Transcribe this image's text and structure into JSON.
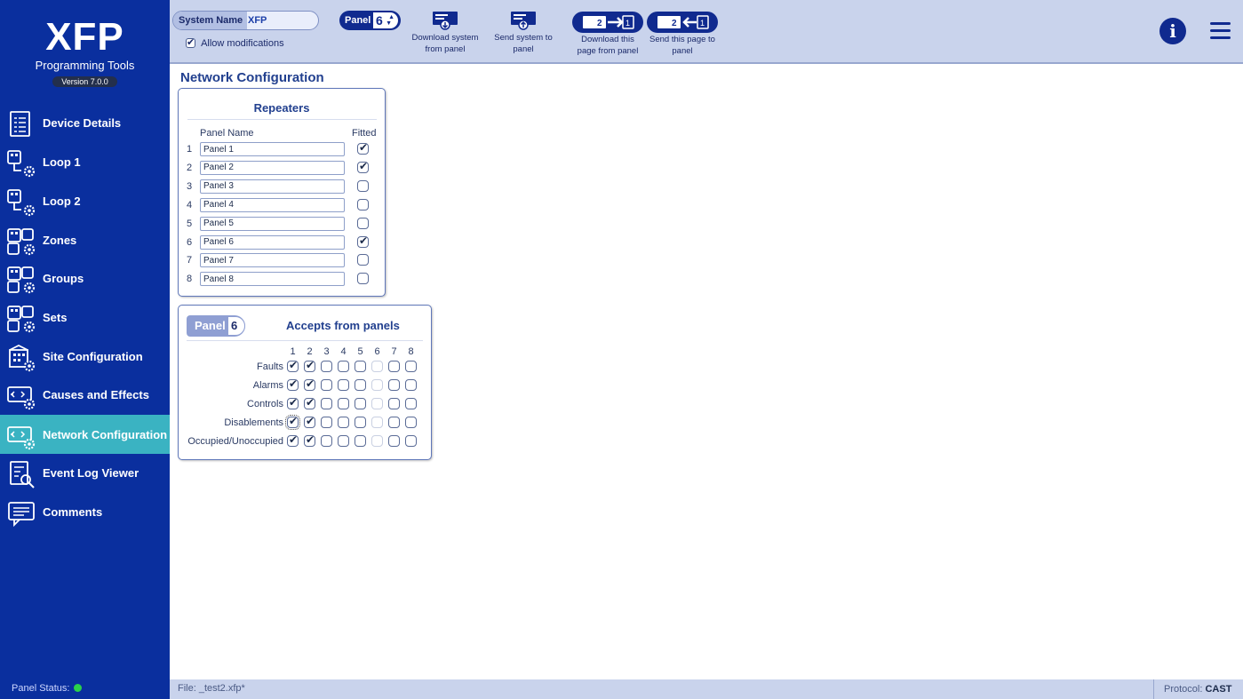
{
  "app": {
    "logo": "XFP",
    "subtitle": "Programming Tools",
    "version": "Version 7.0.0"
  },
  "sidebar": {
    "items": [
      {
        "label": "Device Details",
        "icon": "document-list-icon",
        "active": false
      },
      {
        "label": "Loop 1",
        "icon": "loop-gear-icon",
        "active": false
      },
      {
        "label": "Loop 2",
        "icon": "loop-gear-icon",
        "active": false
      },
      {
        "label": "Zones",
        "icon": "zones-gear-icon",
        "active": false
      },
      {
        "label": "Groups",
        "icon": "groups-gear-icon",
        "active": false
      },
      {
        "label": "Sets",
        "icon": "sets-gear-icon",
        "active": false
      },
      {
        "label": "Site Configuration",
        "icon": "building-gear-icon",
        "active": false
      },
      {
        "label": "Causes and Effects",
        "icon": "cause-effect-gear-icon",
        "active": false
      },
      {
        "label": "Network Configuration",
        "icon": "network-gear-icon",
        "active": true
      },
      {
        "label": "Event Log Viewer",
        "icon": "log-search-icon",
        "active": false
      },
      {
        "label": "Comments",
        "icon": "comment-icon",
        "active": false
      }
    ],
    "panel_status_label": "Panel Status:",
    "panel_status_color": "#2ad14a"
  },
  "toolbar": {
    "system_name_label": "System Name",
    "system_name_value": "XFP",
    "allow_modifications_label": "Allow modifications",
    "allow_modifications_checked": true,
    "panel_label": "Panel",
    "panel_value": "6",
    "download_system_label": "Download system from panel",
    "send_system_label": "Send system to panel",
    "download_page_label": "Download this page from panel",
    "send_page_label": "Send this page to panel"
  },
  "main": {
    "title": "Network Configuration",
    "repeaters": {
      "title": "Repeaters",
      "col_name": "Panel Name",
      "col_fitted": "Fitted",
      "rows": [
        {
          "num": "1",
          "name": "Panel 1",
          "fitted": true
        },
        {
          "num": "2",
          "name": "Panel 2",
          "fitted": true
        },
        {
          "num": "3",
          "name": "Panel 3",
          "fitted": false
        },
        {
          "num": "4",
          "name": "Panel 4",
          "fitted": false
        },
        {
          "num": "5",
          "name": "Panel 5",
          "fitted": false
        },
        {
          "num": "6",
          "name": "Panel 6",
          "fitted": true
        },
        {
          "num": "7",
          "name": "Panel 7",
          "fitted": false
        },
        {
          "num": "8",
          "name": "Panel 8",
          "fitted": false
        }
      ]
    },
    "accepts": {
      "panel_label": "Panel",
      "panel_value": "6",
      "title": "Accepts from panels",
      "columns": [
        "1",
        "2",
        "3",
        "4",
        "5",
        "6",
        "7",
        "8"
      ],
      "rows": [
        {
          "label": "Faults",
          "values": [
            true,
            true,
            false,
            false,
            false,
            false,
            false,
            false
          ]
        },
        {
          "label": "Alarms",
          "values": [
            true,
            true,
            false,
            false,
            false,
            false,
            false,
            false
          ]
        },
        {
          "label": "Controls",
          "values": [
            true,
            true,
            false,
            false,
            false,
            false,
            false,
            false
          ]
        },
        {
          "label": "Disablements",
          "values": [
            true,
            true,
            false,
            false,
            false,
            false,
            false,
            false
          ]
        },
        {
          "label": "Occupied/Unoccupied",
          "values": [
            true,
            true,
            false,
            false,
            false,
            false,
            false,
            false
          ]
        }
      ]
    }
  },
  "statusbar": {
    "file": "File: _test2.xfp*",
    "protocol_label": "Protocol:",
    "protocol_value": "CAST"
  }
}
